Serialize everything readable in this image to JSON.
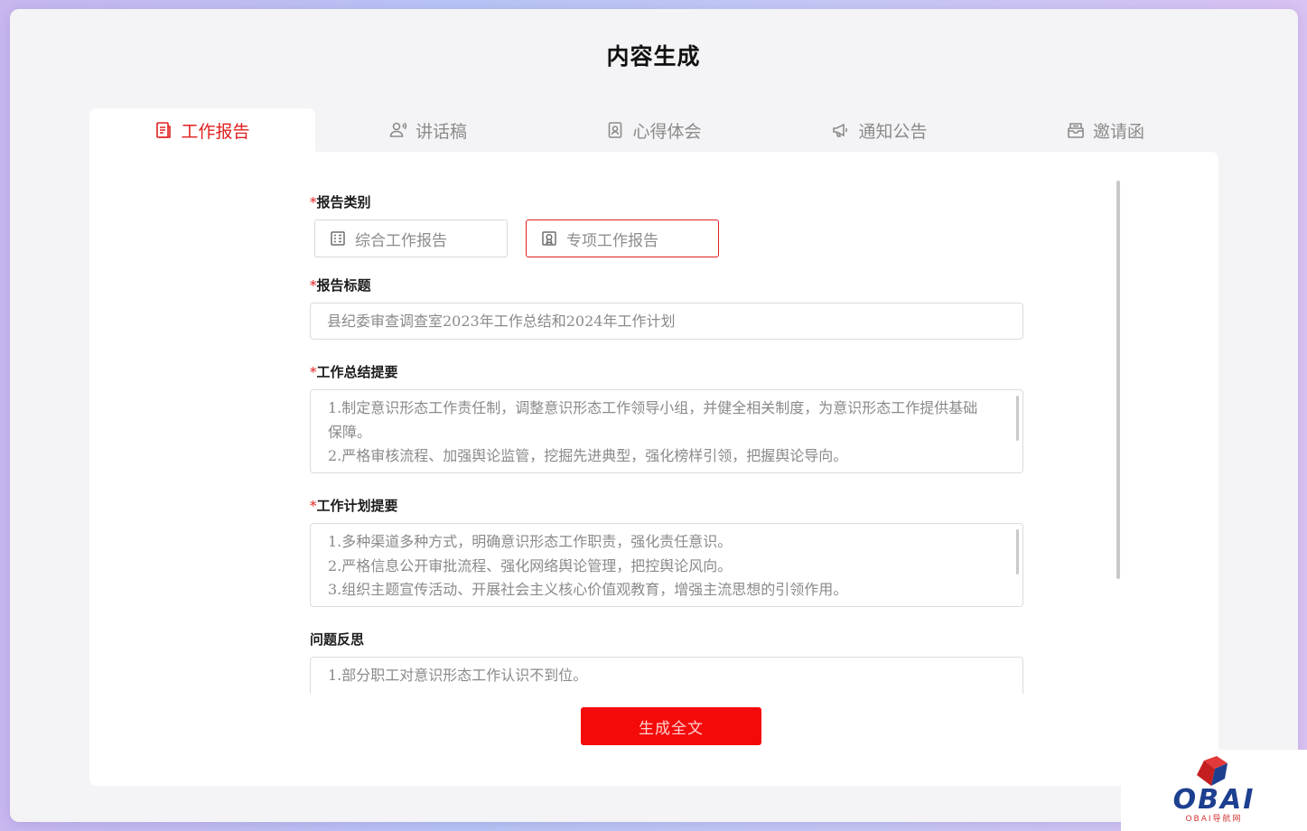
{
  "page": {
    "title": "内容生成"
  },
  "tabs": [
    {
      "label": "工作报告",
      "icon": "document-icon",
      "active": true
    },
    {
      "label": "讲话稿",
      "icon": "speaker-person-icon",
      "active": false
    },
    {
      "label": "心得体会",
      "icon": "notebook-icon",
      "active": false
    },
    {
      "label": "通知公告",
      "icon": "megaphone-icon",
      "active": false
    },
    {
      "label": "邀请函",
      "icon": "envelope-icon",
      "active": false
    }
  ],
  "form": {
    "required_mark": "*",
    "report_type": {
      "label": "报告类别",
      "options": [
        {
          "label": "综合工作报告",
          "icon": "building-icon",
          "selected": false
        },
        {
          "label": "专项工作报告",
          "icon": "badge-icon",
          "selected": true
        }
      ]
    },
    "report_title": {
      "label": "报告标题",
      "value": "县纪委审查调查室2023年工作总结和2024年工作计划"
    },
    "summary": {
      "label": "工作总结提要",
      "lines": [
        "1.制定意识形态工作责任制，调整意识形态工作领导小组，并健全相关制度，为意识形态工作提供基础保障。",
        "2.严格审核流程、加强舆论监管，挖掘先进典型，强化榜样引领，把握舆论导向。"
      ]
    },
    "plan": {
      "label": "工作计划提要",
      "lines": [
        "1.多种渠道多种方式，明确意识形态工作职责，强化责任意识。",
        "2.严格信息公开审批流程、强化网络舆论管理，把控舆论风向。",
        "3.组织主题宣传活动、开展社会主义核心价值观教育，增强主流思想的引领作用。"
      ]
    },
    "reflection": {
      "label": "问题反思",
      "lines": [
        "1.部分职工对意识形态工作认识不到位。"
      ]
    }
  },
  "actions": {
    "generate_label": "生成全文"
  },
  "branding": {
    "logo_text": "OBAI",
    "logo_subtext": "OBAI导航网",
    "accent_color": "#e02020",
    "button_color": "#f50a0a"
  }
}
